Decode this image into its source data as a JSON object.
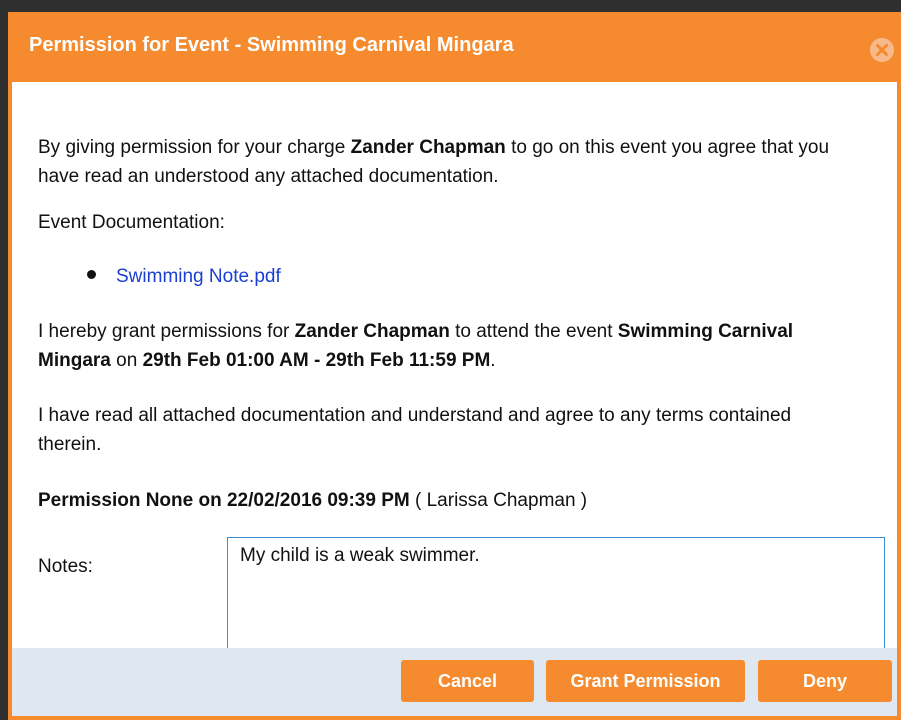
{
  "dialog": {
    "title": "Permission for Event - Swimming Carnival Mingara",
    "close_icon": "close-circle-icon"
  },
  "intro": {
    "prefix": "By giving permission for your charge ",
    "child_name": "Zander Chapman",
    "suffix": " to go on this event you agree that you have read an understood any attached documentation."
  },
  "documentation": {
    "label": "Event Documentation:",
    "files": [
      "Swimming Note.pdf"
    ]
  },
  "grant": {
    "prefix": "I hereby grant permissions for ",
    "child_name": "Zander Chapman",
    "middle": " to attend the event ",
    "event_name": "Swimming Carnival Mingara",
    "on": " on ",
    "date_range": "29th Feb 01:00 AM - 29th Feb 11:59 PM",
    "end": "."
  },
  "agreement": "I have read all attached documentation and understand and agree to any terms contained therein.",
  "status": {
    "text": "Permission None on 22/02/2016 09:39 PM",
    "by": " ( Larissa Chapman )"
  },
  "notes": {
    "label": "Notes:",
    "value": "My child is a weak swimmer."
  },
  "buttons": {
    "cancel": "Cancel",
    "grant": "Grant Permission",
    "deny": "Deny"
  }
}
